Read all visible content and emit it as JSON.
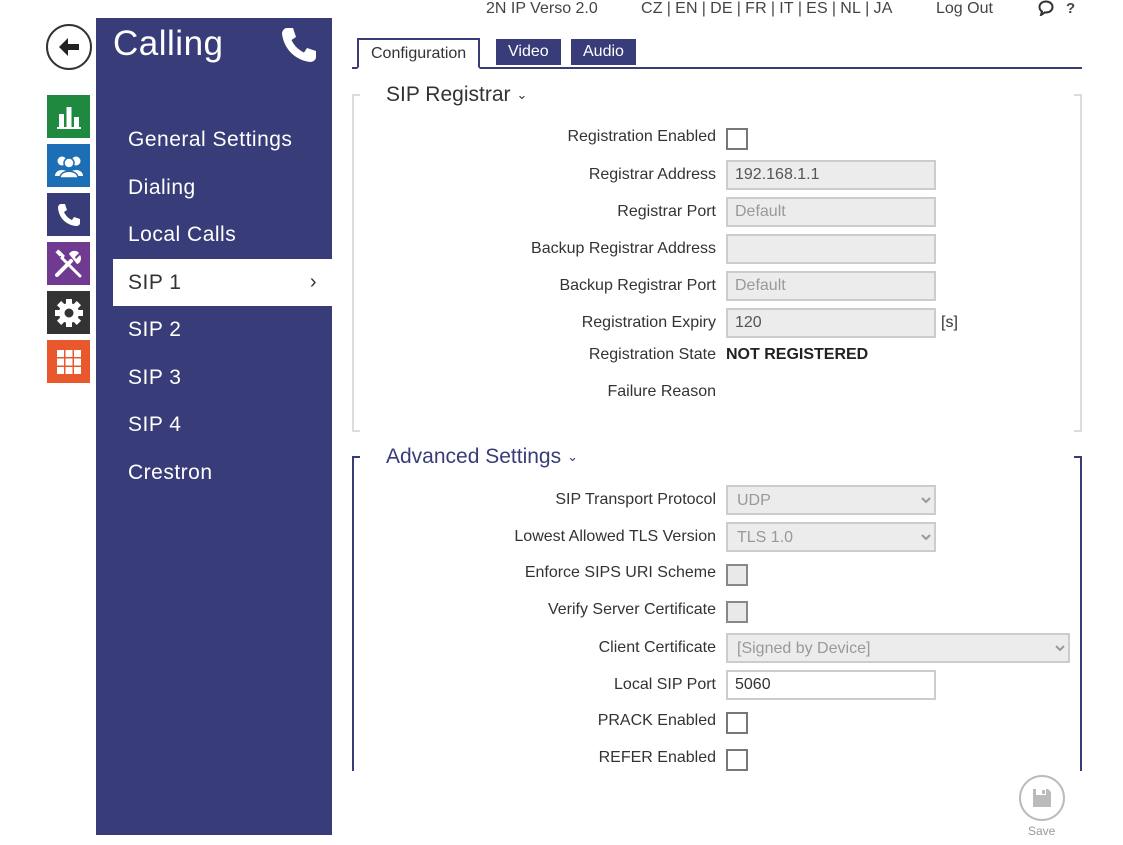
{
  "header": {
    "device_name": "2N IP Verso 2.0",
    "languages": [
      "CZ",
      "EN",
      "DE",
      "FR",
      "IT",
      "ES",
      "NL",
      "JA"
    ],
    "logout": "Log Out",
    "help": "?"
  },
  "rail": {
    "items": [
      {
        "icon": "bar-chart-icon",
        "color": "#1f8a3f"
      },
      {
        "icon": "users-icon",
        "color": "#1c6fb4"
      },
      {
        "icon": "phone-icon",
        "color": "#383c78"
      },
      {
        "icon": "tools-icon",
        "color": "#6f3a8f"
      },
      {
        "icon": "gear-icon",
        "color": "#333333"
      },
      {
        "icon": "grid-icon",
        "color": "#e8582c"
      }
    ]
  },
  "sidebar": {
    "title": "Calling",
    "items": [
      {
        "label": "General Settings"
      },
      {
        "label": "Dialing"
      },
      {
        "label": "Local Calls"
      },
      {
        "label": "SIP 1",
        "active": true
      },
      {
        "label": "SIP 2"
      },
      {
        "label": "SIP 3"
      },
      {
        "label": "SIP 4"
      },
      {
        "label": "Crestron"
      }
    ],
    "chevron": "›"
  },
  "tabs": [
    {
      "label": "Configuration",
      "active": true
    },
    {
      "label": "Video"
    },
    {
      "label": "Audio"
    }
  ],
  "registrar": {
    "title": "SIP Registrar",
    "chevron": "⌄",
    "registration_enabled_label": "Registration Enabled",
    "registrar_address_label": "Registrar Address",
    "registrar_address_value": "192.168.1.1",
    "registrar_port_label": "Registrar Port",
    "registrar_port_placeholder": "Default",
    "backup_address_label": "Backup Registrar Address",
    "backup_port_label": "Backup Registrar Port",
    "backup_port_placeholder": "Default",
    "expiry_label": "Registration Expiry",
    "expiry_value": "120",
    "expiry_unit": "[s]",
    "state_label": "Registration State",
    "state_value": "NOT REGISTERED",
    "failure_label": "Failure Reason"
  },
  "advanced": {
    "title": "Advanced Settings",
    "chevron": "⌄",
    "transport_label": "SIP Transport Protocol",
    "transport_value": "UDP",
    "tls_label": "Lowest Allowed TLS Version",
    "tls_value": "TLS 1.0",
    "sips_label": "Enforce SIPS URI Scheme",
    "verify_label": "Verify Server Certificate",
    "client_cert_label": "Client Certificate",
    "client_cert_value": "[Signed by Device]",
    "local_port_label": "Local SIP Port",
    "local_port_value": "5060",
    "prack_label": "PRACK Enabled",
    "refer_label": "REFER Enabled"
  },
  "save": {
    "label": "Save"
  }
}
